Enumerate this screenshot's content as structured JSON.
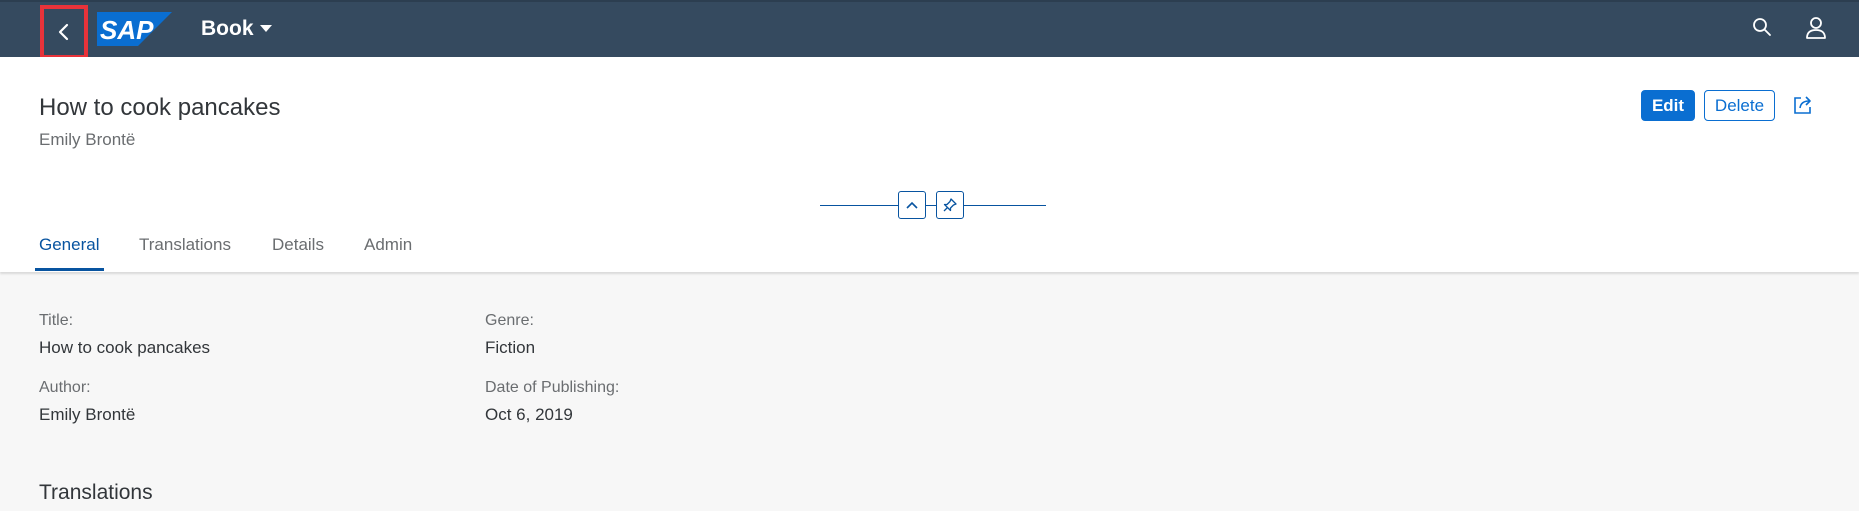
{
  "shell": {
    "logo_text": "SAP",
    "app_title": "Book",
    "back_icon": "chevron-left-icon",
    "search_icon": "search-icon",
    "user_icon": "user-icon"
  },
  "header": {
    "title": "How to cook pancakes",
    "subtitle": "Emily Brontë",
    "actions": {
      "edit": "Edit",
      "delete": "Delete"
    }
  },
  "tabs": [
    {
      "label": "General",
      "active": true
    },
    {
      "label": "Translations",
      "active": false
    },
    {
      "label": "Details",
      "active": false
    },
    {
      "label": "Admin",
      "active": false
    }
  ],
  "general": {
    "title_label": "Title:",
    "title_value": "How to cook pancakes",
    "author_label": "Author:",
    "author_value": "Emily Brontë",
    "genre_label": "Genre:",
    "genre_value": "Fiction",
    "date_label": "Date of Publishing:",
    "date_value": "Oct 6, 2019"
  },
  "translations_section": {
    "title": "Translations"
  },
  "colors": {
    "shell_bg": "#354a5f",
    "accent": "#0a6ed1",
    "highlight": "#e8333a"
  }
}
